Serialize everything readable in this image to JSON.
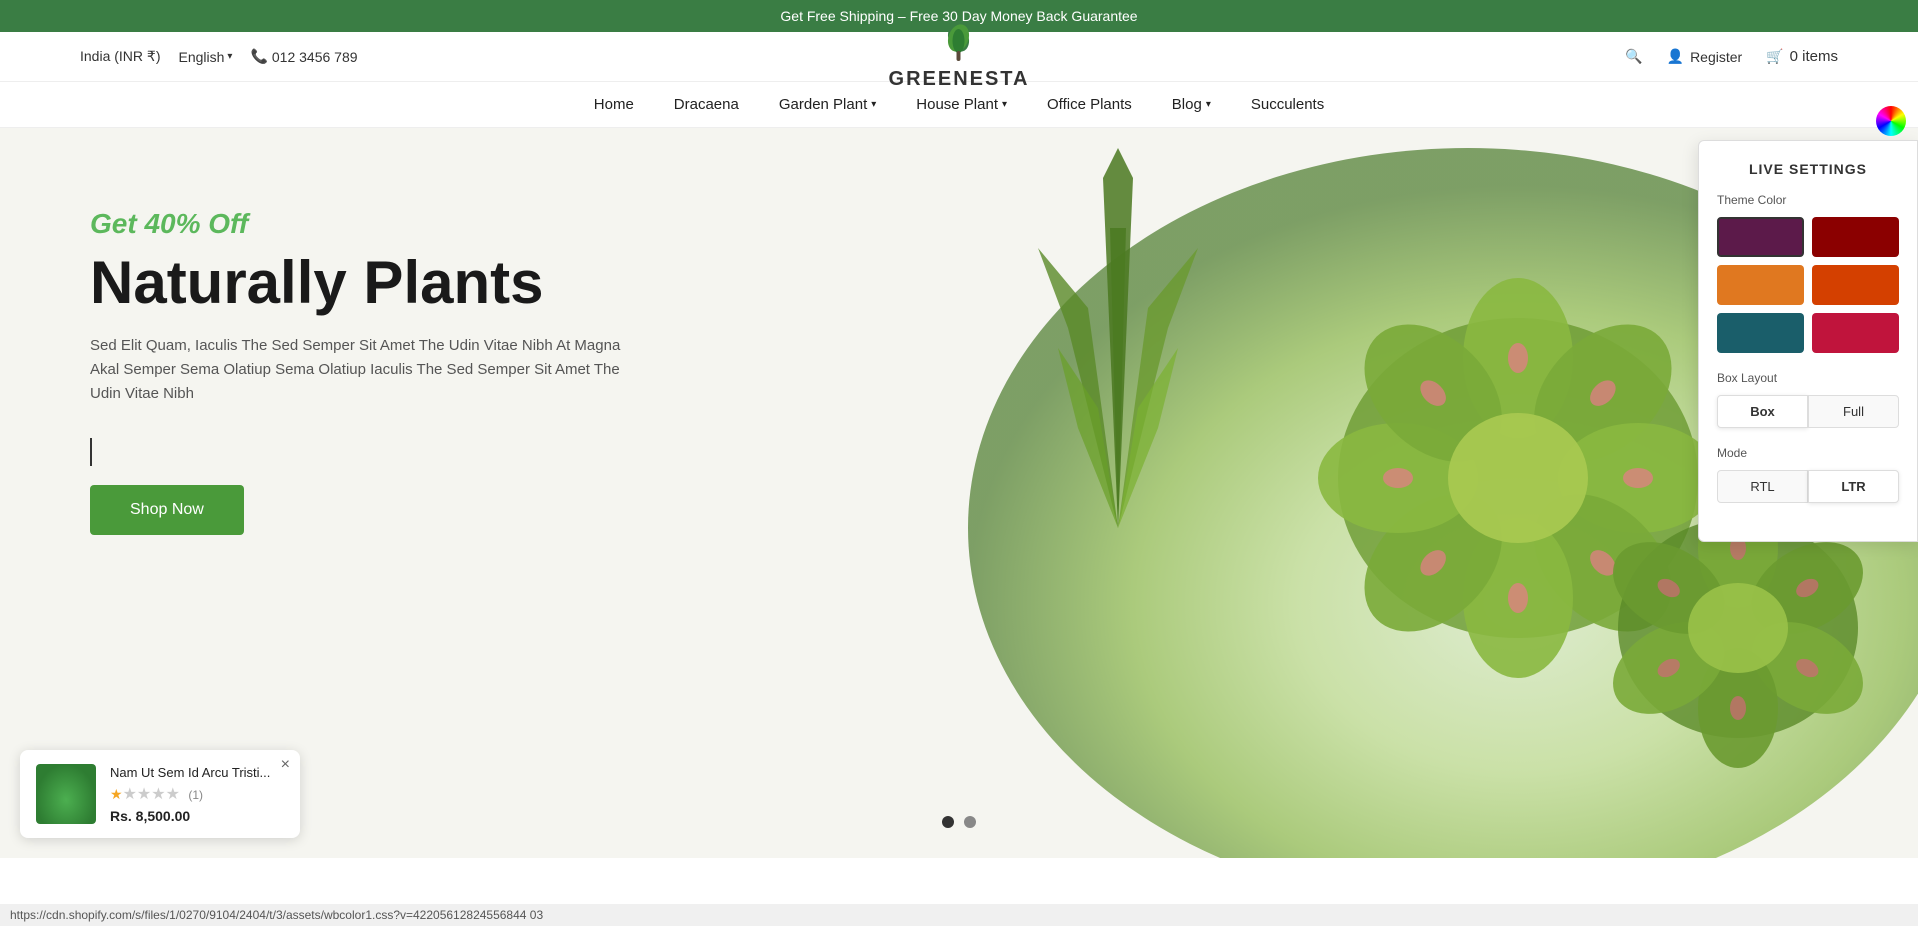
{
  "banner": {
    "text": "Get Free Shipping – Free 30 Day Money Back Guarantee"
  },
  "header": {
    "currency": "India (INR ₹)",
    "language": "English",
    "phone": "012 3456 789",
    "logo_text": "GREENESTA",
    "search_label": "Search",
    "register_label": "Register",
    "cart_label": "items",
    "cart_count": "0",
    "cart_full": "0 items"
  },
  "nav": {
    "items": [
      {
        "label": "Home",
        "has_dropdown": false
      },
      {
        "label": "Dracaena",
        "has_dropdown": false
      },
      {
        "label": "Garden Plant",
        "has_dropdown": true
      },
      {
        "label": "House Plant",
        "has_dropdown": true
      },
      {
        "label": "Office Plants",
        "has_dropdown": false
      },
      {
        "label": "Blog",
        "has_dropdown": true
      },
      {
        "label": "Succulents",
        "has_dropdown": false
      }
    ]
  },
  "hero": {
    "discount": "Get 40% Off",
    "title": "Naturally Plants",
    "description": "Sed Elit Quam, Iaculis The Sed Semper Sit Amet The Udin Vitae Nibh At Magna Akal Semper Sema Olatiup Sema Olatiup Iaculis The Sed Semper Sit Amet The Udin Vitae Nibh",
    "cta": "Shop Now"
  },
  "slide_dots": {
    "active": 0,
    "count": 2
  },
  "product_popup": {
    "name": "Nam Ut Sem Id Arcu Tristi...",
    "rating": 1,
    "max_rating": 5,
    "review_count": "(1)",
    "price": "Rs. 8,500.00",
    "close": "×"
  },
  "live_settings": {
    "title": "LIVE SETTINGS",
    "theme_color_label": "Theme Color",
    "colors": [
      {
        "value": "#5c1a4a",
        "label": "Purple"
      },
      {
        "value": "#8b0000",
        "label": "DarkRed"
      },
      {
        "value": "#e07820",
        "label": "Orange"
      },
      {
        "value": "#d44000",
        "label": "OrangeRed"
      },
      {
        "value": "#1a5e6a",
        "label": "Teal"
      },
      {
        "value": "#c0143c",
        "label": "Crimson"
      }
    ],
    "box_layout_label": "Box Layout",
    "layout_options": [
      {
        "label": "Box",
        "active": true
      },
      {
        "label": "Full",
        "active": false
      }
    ],
    "mode_label": "Mode",
    "mode_options": [
      {
        "label": "RTL",
        "active": false
      },
      {
        "label": "LTR",
        "active": true
      }
    ]
  },
  "status_bar": {
    "url": "https://cdn.shopify.com/s/files/1/0270/9104/2404/t/3/assets/wbcolor1.css?v=42205612824556844 03"
  }
}
